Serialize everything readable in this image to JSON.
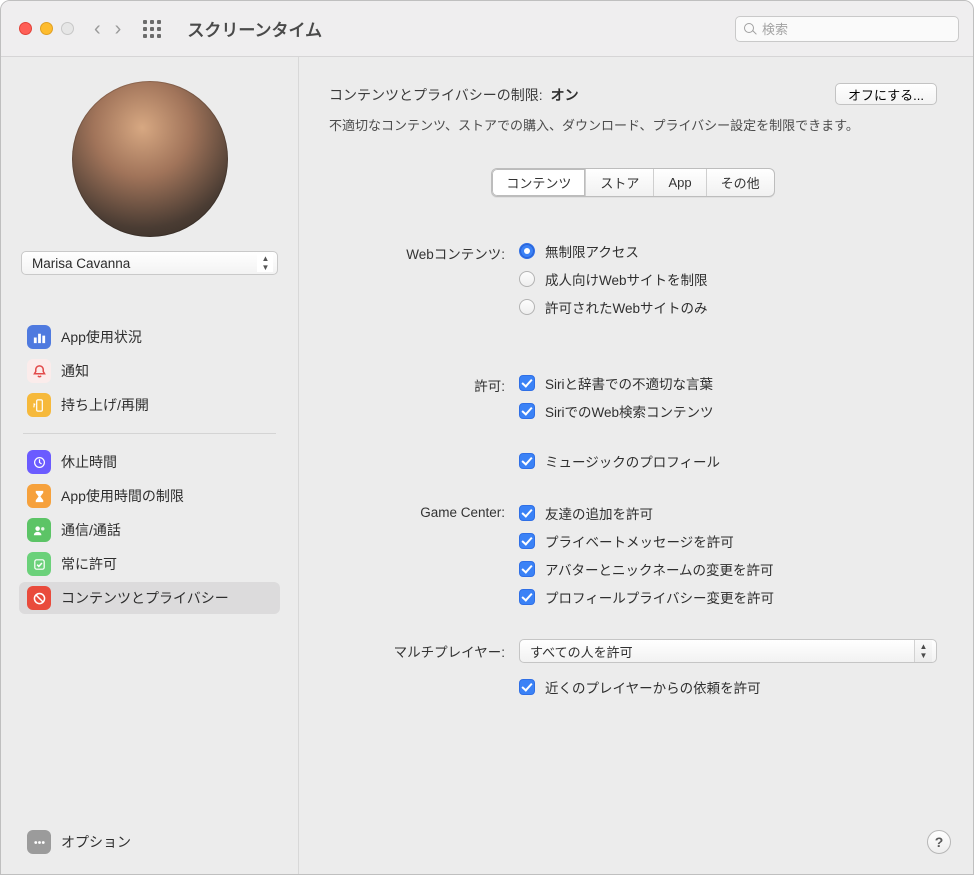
{
  "window": {
    "title": "スクリーンタイム"
  },
  "search": {
    "placeholder": "検索"
  },
  "user": {
    "name": "Marisa Cavanna"
  },
  "sidebar": {
    "section1": [
      {
        "label": "App使用状況"
      },
      {
        "label": "通知"
      },
      {
        "label": "持ち上げ/再開"
      }
    ],
    "section2": [
      {
        "label": "休止時間"
      },
      {
        "label": "App使用時間の制限"
      },
      {
        "label": "通信/通話"
      },
      {
        "label": "常に許可"
      },
      {
        "label": "コンテンツとプライバシー"
      }
    ],
    "options": "オプション"
  },
  "header": {
    "label": "コンテンツとプライバシーの制限:",
    "status": "オン",
    "offButton": "オフにする...",
    "desc": "不適切なコンテンツ、ストアでの購入、ダウンロード、プライバシー設定を制限できます。"
  },
  "tabs": [
    "コンテンツ",
    "ストア",
    "App",
    "その他"
  ],
  "form": {
    "webLabel": "Webコンテンツ:",
    "web": [
      "無制限アクセス",
      "成人向けWebサイトを制限",
      "許可されたWebサイトのみ"
    ],
    "allowLabel": "許可:",
    "allow": [
      "Siriと辞書での不適切な言葉",
      "SiriでのWeb検索コンテンツ",
      "ミュージックのプロフィール"
    ],
    "gcLabel": "Game Center:",
    "gc": [
      "友達の追加を許可",
      "プライベートメッセージを許可",
      "アバターとニックネームの変更を許可",
      "プロフィールプライバシー変更を許可"
    ],
    "mpLabel": "マルチプレイヤー:",
    "mpValue": "すべての人を許可",
    "mpNearby": "近くのプレイヤーからの依頼を許可"
  },
  "help": "?"
}
